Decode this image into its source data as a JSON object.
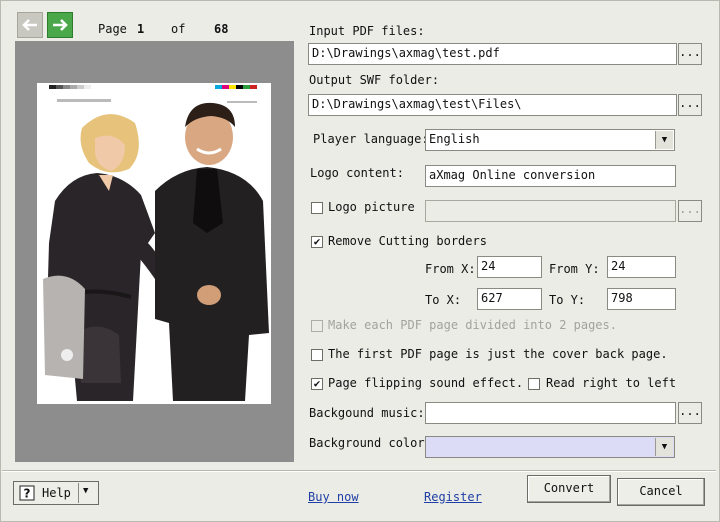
{
  "nav": {
    "prev_icon": "arrow-left-icon",
    "next_icon": "arrow-right-icon"
  },
  "pager": {
    "page_label": "Page",
    "current": "1",
    "of_label": "of",
    "total": "68"
  },
  "form": {
    "input_pdf_label": "Input PDF files:",
    "input_pdf_value": "D:\\Drawings\\axmag\\test.pdf",
    "output_swf_label": "Output SWF folder:",
    "output_swf_value": "D:\\Drawings\\axmag\\test\\Files\\",
    "player_language_label": "Player language:",
    "player_language_value": "English",
    "logo_content_label": "Logo content:",
    "logo_content_value": "aXmag Online conversion",
    "logo_picture_label": "Logo picture",
    "logo_picture_checked": false,
    "remove_cutting_label": "Remove Cutting borders",
    "remove_cutting_checked": true,
    "from_x_label": "From X:",
    "from_x_value": "24",
    "from_y_label": "From Y:",
    "from_y_value": "24",
    "to_x_label": "To X:",
    "to_x_value": "627",
    "to_y_label": "To Y:",
    "to_y_value": "798",
    "divide_pages_label": "Make each PDF page divided into 2 pages.",
    "first_page_cover_label": "The first PDF page is just the cover back page.",
    "flip_sound_label": "Page flipping sound effect.",
    "flip_sound_checked": true,
    "read_rtl_label": "Read right to left",
    "bg_music_label": "Backgound music:",
    "bg_music_value": "",
    "bg_color_label": "Background color:",
    "bg_color_swatch": "#dcdcf6",
    "browse_label": "..."
  },
  "footer": {
    "help_label": "Help",
    "help_icon": "help-question-icon",
    "buy_now_label": "Buy now",
    "register_label": "Register",
    "convert_label": "Convert",
    "cancel_label": "Cancel"
  },
  "colors": {
    "accent_green": "#4aa84a",
    "link_blue": "#1f3ea6",
    "preview_bg": "#8d8d8d"
  }
}
